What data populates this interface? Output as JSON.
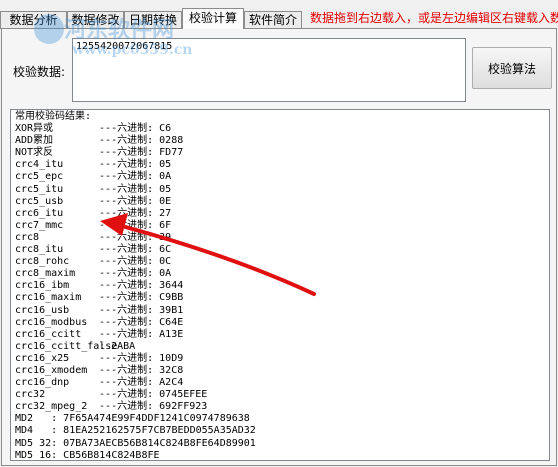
{
  "tabs": [
    {
      "label": "数据分析",
      "active": false
    },
    {
      "label": "数据修改",
      "active": false
    },
    {
      "label": "日期转换",
      "active": false
    },
    {
      "label": "校验计算",
      "active": true
    },
    {
      "label": "软件简介",
      "active": false
    }
  ],
  "notice": "数据拖到右边载入，或是左边编辑区右键载入数据",
  "form": {
    "label": "校验数据:",
    "input_value": "1255420072067815",
    "button_label": "校验算法"
  },
  "results": {
    "header": "常用校验码结果:",
    "rows": [
      {
        "name": "XOR异或",
        "sep": "  ---六进制: ",
        "value": "C6"
      },
      {
        "name": "ADD累加",
        "sep": "  ---六进制: ",
        "value": "0288"
      },
      {
        "name": "NOT求反",
        "sep": "  ---六进制: ",
        "value": "FD77"
      },
      {
        "name": "crc4_itu",
        "sep": "  ---六进制: ",
        "value": "05"
      },
      {
        "name": "crc5_epc",
        "sep": "  ---六进制: ",
        "value": "0A"
      },
      {
        "name": "crc5_itu",
        "sep": "  ---六进制: ",
        "value": "05"
      },
      {
        "name": "crc5_usb",
        "sep": "  ---六进制: ",
        "value": "0E"
      },
      {
        "name": "crc6_itu",
        "sep": "  ---六进制: ",
        "value": "27"
      },
      {
        "name": "crc7_mmc",
        "sep": "  ---六进制: ",
        "value": "6F"
      },
      {
        "name": "crc8",
        "sep": "  ---六进制: ",
        "value": "39"
      },
      {
        "name": "crc8_itu",
        "sep": "  ---六进制: ",
        "value": "6C"
      },
      {
        "name": "crc8_rohc",
        "sep": "  ---六进制: ",
        "value": "0C"
      },
      {
        "name": "crc8_maxim",
        "sep": "  ---六进制: ",
        "value": "0A"
      },
      {
        "name": "crc16_ibm",
        "sep": "  ---六进制: ",
        "value": "3644"
      },
      {
        "name": "crc16_maxim",
        "sep": "  ---六进制: ",
        "value": "C9BB"
      },
      {
        "name": "crc16_usb",
        "sep": "  ---六进制: ",
        "value": "39B1"
      },
      {
        "name": "crc16_modbus",
        "sep": "  ---六进制: ",
        "value": "C64E"
      },
      {
        "name": "crc16_ccitt",
        "sep": "  ---六进制: ",
        "value": "A13E"
      },
      {
        "name": "crc16_ccitt_false",
        "sep": "  : ",
        "value": "2ABA"
      },
      {
        "name": "crc16_x25",
        "sep": "  ---六进制: ",
        "value": "10D9"
      },
      {
        "name": "crc16_xmodem",
        "sep": "  ---六进制: ",
        "value": "32C8"
      },
      {
        "name": "crc16_dnp",
        "sep": "  ---六进制: ",
        "value": "A2C4"
      },
      {
        "name": "crc32",
        "sep": "  ---六进制: ",
        "value": "0745EFEE"
      },
      {
        "name": "crc32_mpeg_2",
        "sep": "  ---六进制: ",
        "value": "692FF923"
      }
    ],
    "md_rows": [
      {
        "label": "MD2   : ",
        "value": "7F65A474E99F4DDF1241C0974789638"
      },
      {
        "label": "MD4   : ",
        "value": "81EA252162575F7CB7BEDD055A35AD32"
      },
      {
        "label": "MD5 32: ",
        "value": "07BA73AECB56B814C824B8FE64D89901"
      },
      {
        "label": "MD5 16: ",
        "value": "CB56B814C824B8FE"
      }
    ]
  },
  "watermark": {
    "line1": "河东软件网",
    "line2": "www.pc0359.cn"
  },
  "colors": {
    "notice": "#e00000",
    "arrow": "#e01010",
    "watermark": "#3a8fd6"
  }
}
